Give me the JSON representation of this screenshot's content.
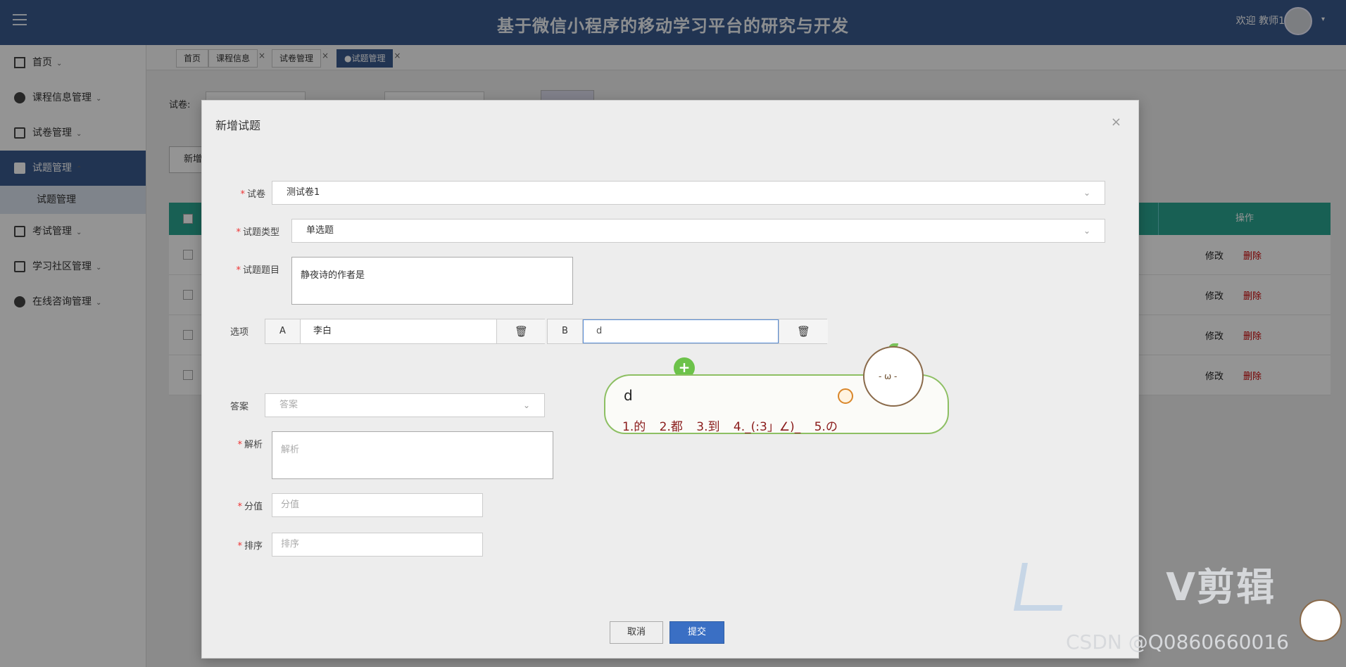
{
  "header": {
    "title": "基于微信小程序的移动学习平台的研究与开发",
    "welcome": "欢迎 教师1"
  },
  "sidebar": {
    "items": [
      {
        "label": "首页"
      },
      {
        "label": "课程信息管理"
      },
      {
        "label": "试卷管理"
      },
      {
        "label": "试题管理"
      },
      {
        "label": "考试管理"
      },
      {
        "label": "学习社区管理"
      },
      {
        "label": "在线咨询管理"
      }
    ],
    "sub_item": "试题管理"
  },
  "tabs": [
    {
      "label": "首页"
    },
    {
      "label": "课程信息"
    },
    {
      "label": "试卷管理"
    },
    {
      "label": "●试题管理"
    }
  ],
  "content": {
    "filter_label": "试卷:",
    "new_button": "新增",
    "op_header": "操作",
    "row_edit": "修改",
    "row_delete": "删除"
  },
  "modal": {
    "title": "新增试题",
    "paper_label": "试卷",
    "paper_value": "测试卷1",
    "type_label": "试题类型",
    "type_value": "单选题",
    "question_label": "试题题目",
    "question_value": "静夜诗的作者是",
    "options_label": "选项",
    "option_a_letter": "A",
    "option_a_value": "李白",
    "option_b_letter": "B",
    "option_b_value": "d",
    "answer_label": "答案",
    "answer_placeholder": "答案",
    "analysis_label": "解析",
    "analysis_placeholder": "解析",
    "score_label": "分值",
    "score_placeholder": "分值",
    "order_label": "排序",
    "order_placeholder": "排序",
    "cancel": "取消",
    "submit": "提交"
  },
  "ime": {
    "composition": "d",
    "candidates": [
      "1.的",
      "2.都",
      "3.到",
      "4._(:3」∠)_",
      "5.の"
    ]
  },
  "watermark": {
    "brand": "V剪辑",
    "csdn": "CSDN @Q0860660016"
  }
}
